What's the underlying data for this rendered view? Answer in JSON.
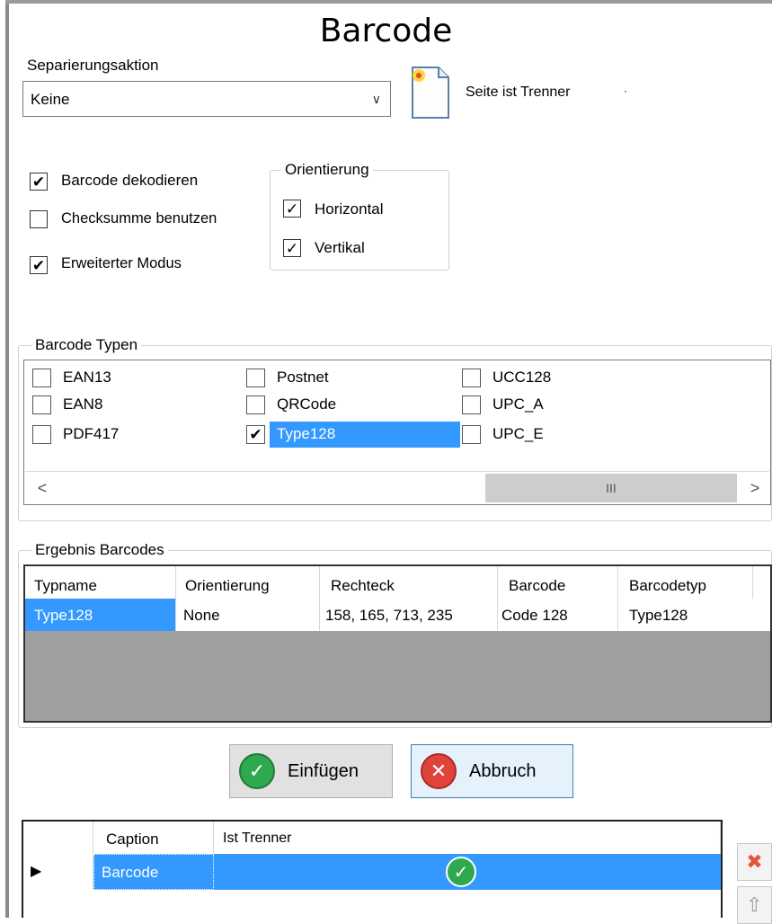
{
  "title": "Barcode",
  "separation": {
    "label": "Separierungsaktion",
    "selected": "Keine",
    "page_label": "Seite ist Trenner"
  },
  "options": {
    "decode": {
      "label": "Barcode dekodieren",
      "checked": true
    },
    "checksum": {
      "label": "Checksumme benutzen",
      "checked": false
    },
    "extended": {
      "label": "Erweiterter Modus",
      "checked": true
    }
  },
  "orientation": {
    "title": "Orientierung",
    "horizontal": {
      "label": "Horizontal",
      "checked": true
    },
    "vertical": {
      "label": "Vertikal",
      "checked": true
    }
  },
  "barcode_types": {
    "title": "Barcode Typen",
    "items": [
      {
        "label": "EAN13",
        "checked": false
      },
      {
        "label": "EAN8",
        "checked": false
      },
      {
        "label": "PDF417",
        "checked": false
      },
      {
        "label": "Postnet",
        "checked": false
      },
      {
        "label": "QRCode",
        "checked": false
      },
      {
        "label": "Type128",
        "checked": true,
        "selected": true
      },
      {
        "label": "UCC128",
        "checked": false
      },
      {
        "label": "UPC_A",
        "checked": false
      },
      {
        "label": "UPC_E",
        "checked": false
      }
    ],
    "scroll_left": "<",
    "scroll_right": ">",
    "scroll_grip": "III"
  },
  "results": {
    "title": "Ergebnis Barcodes",
    "columns": [
      "Typname",
      "Orientierung",
      "Rechteck",
      "Barcode",
      "Barcodetyp"
    ],
    "rows": [
      [
        "Type128",
        "None",
        "158, 165, 713, 235",
        "Code 128",
        "Type128"
      ]
    ]
  },
  "buttons": {
    "insert": "Einfügen",
    "cancel": "Abbruch"
  },
  "caption_grid": {
    "columns": [
      "Caption",
      "Ist Trenner"
    ],
    "rows": [
      {
        "caption": "Barcode",
        "is_separator": true
      }
    ]
  },
  "icons": {
    "document": "new-document-icon",
    "ok": "check-circle-icon",
    "cancel": "x-circle-icon",
    "delete": "delete-x-icon",
    "up": "arrow-up-icon"
  },
  "colors": {
    "selection": "#3399ff",
    "ok_green": "#2fa84f",
    "cancel_red": "#e0433a",
    "grid_empty": "#a0a0a0"
  }
}
